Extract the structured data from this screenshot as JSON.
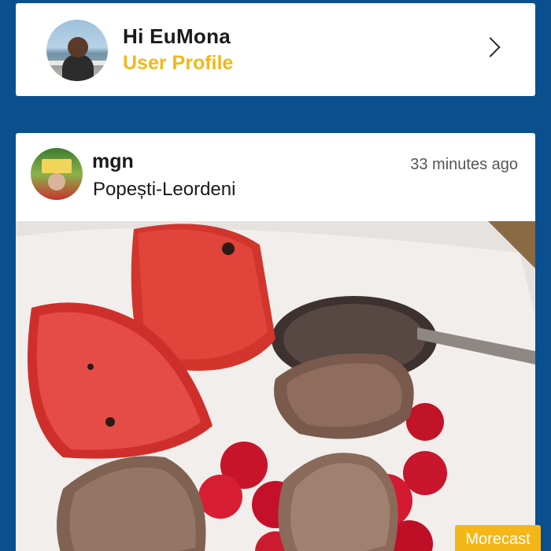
{
  "profile": {
    "greeting": "Hi EuMona",
    "link_label": "User Profile"
  },
  "post": {
    "username": "mgn",
    "location": "Popești-Leordeni",
    "time": "33 minutes ago"
  },
  "badge": {
    "label": "Morecast"
  },
  "icons": {
    "chevron": "chevron-right-icon"
  },
  "colors": {
    "background": "#0a4f8e",
    "accent": "#f3b71b",
    "badge": "#f5b617"
  }
}
